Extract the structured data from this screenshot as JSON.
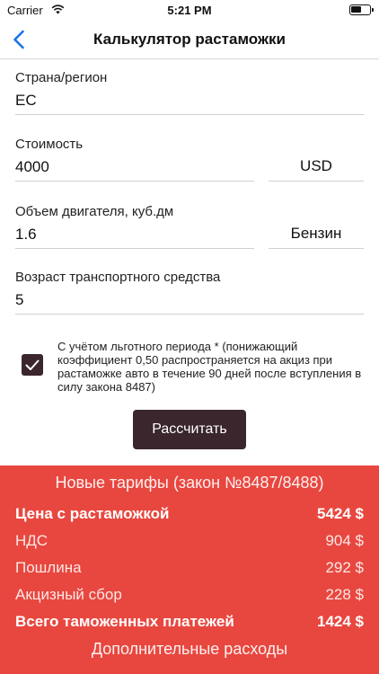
{
  "status_bar": {
    "carrier": "Carrier",
    "time": "5:21 PM",
    "wifi_icon": "wifi-icon",
    "battery_icon": "battery-icon",
    "battery_level": 0.6
  },
  "nav": {
    "title": "Калькулятор растаможки",
    "back_icon": "chevron-left-icon",
    "accent_color": "#1a73e8"
  },
  "form": {
    "country_label": "Страна/регион",
    "country_value": "ЕС",
    "cost_label": "Стоимость",
    "cost_value": "4000",
    "currency": "USD",
    "engine_label": "Объем двигателя, куб.дм",
    "engine_value": "1.6",
    "fuel_type": "Бензин",
    "age_label": "Возраст транспортного средства",
    "age_value": "5",
    "grace_checkbox_checked": true,
    "grace_text": "С учётом льготного периода * (понижающий коэффициент 0,50 распространяется на акциз при растаможке авто в течение 90 дней после вступления в силу закона 8487)",
    "calculate_label": "Рассчитать",
    "button_color": "#3a262c"
  },
  "results": {
    "background_color": "#e8473f",
    "title": "Новые тарифы (закон №8487/8488)",
    "rows": [
      {
        "label": "Цена с растаможкой",
        "value": "5424 $",
        "bold": true
      },
      {
        "label": "НДС",
        "value": "904 $",
        "bold": false
      },
      {
        "label": "Пошлина",
        "value": "292 $",
        "bold": false
      },
      {
        "label": "Акцизный сбор",
        "value": "228 $",
        "bold": false
      },
      {
        "label": "Всего таможенных платежей",
        "value": "1424 $",
        "bold": true
      }
    ],
    "extra_link": "Дополнительные расходы"
  }
}
